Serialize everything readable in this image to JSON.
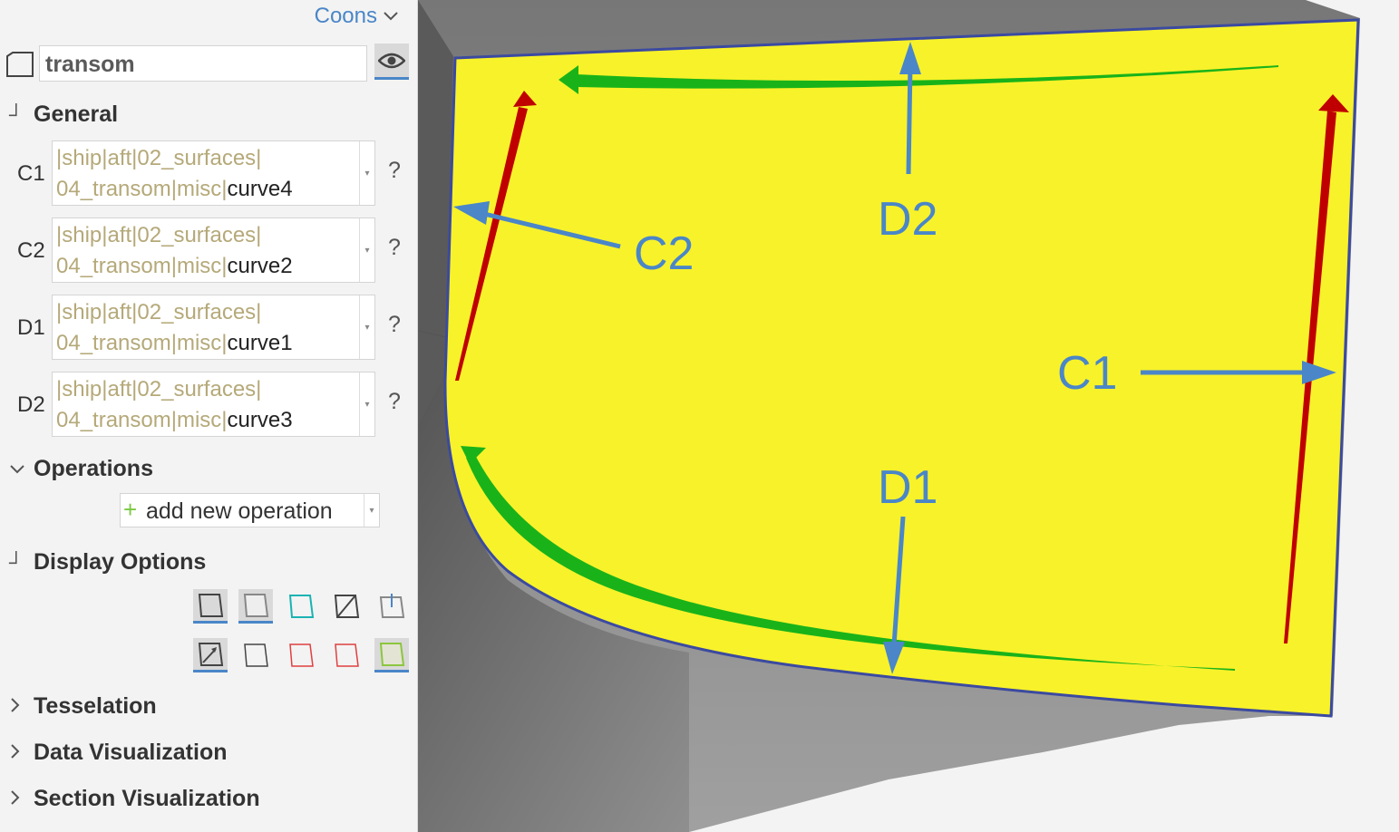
{
  "panel": {
    "type_selector": "Coons",
    "name": "transom",
    "sections": {
      "general": "General",
      "operations": "Operations",
      "display_options": "Display Options",
      "tesselation": "Tesselation",
      "data_visualization": "Data Visualization",
      "section_visualization": "Section Visualization"
    },
    "curves": [
      {
        "label": "C1",
        "path": "|ship|aft|02_surfaces|",
        "path2": "04_transom|misc|",
        "name": "curve4"
      },
      {
        "label": "C2",
        "path": "|ship|aft|02_surfaces|",
        "path2": "04_transom|misc|",
        "name": "curve2"
      },
      {
        "label": "D1",
        "path": "|ship|aft|02_surfaces|",
        "path2": "04_transom|misc|",
        "name": "curve1"
      },
      {
        "label": "D2",
        "path": "|ship|aft|02_surfaces|",
        "path2": "04_transom|misc|",
        "name": "curve3"
      }
    ],
    "help": "?",
    "add_operation": "add new operation"
  },
  "viewport": {
    "annotations": {
      "c1": "C1",
      "c2": "C2",
      "d1": "D1",
      "d2": "D2"
    },
    "colors": {
      "surface": "#f8f22a",
      "u_arrow": "#c00000",
      "v_arrow": "#19b319",
      "annotation": "#4a86c8"
    }
  }
}
